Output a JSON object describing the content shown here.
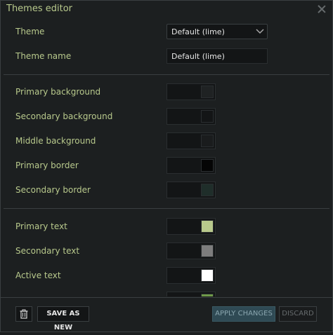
{
  "window": {
    "title": "Themes editor"
  },
  "form": {
    "theme_label": "Theme",
    "theme_value": "Default (lime)",
    "theme_name_label": "Theme name",
    "theme_name_value": "Default (lime)"
  },
  "colors": [
    {
      "label": "Primary background",
      "swatch": "#1f2223"
    },
    {
      "label": "Secondary background",
      "swatch": "#131516"
    },
    {
      "label": "Middle background",
      "swatch": "#1a1c1d"
    },
    {
      "label": "Primary border",
      "swatch": "#050505"
    },
    {
      "label": "Secondary border",
      "swatch": "#1f2e2a"
    },
    {
      "label": "Primary text",
      "swatch": "#b8c98c"
    },
    {
      "label": "Secondary text",
      "swatch": "#7d7d7d"
    },
    {
      "label": "Active text",
      "swatch": "#ffffff"
    },
    {
      "label": "",
      "swatch": "#6f9a49"
    }
  ],
  "footer": {
    "save_as_new": "SAVE AS NEW",
    "apply_changes": "APPLY CHANGES",
    "discard": "DISCARD"
  },
  "icons": {
    "close": "close-icon",
    "chevron": "chevron-down-icon",
    "trash": "trash-icon"
  }
}
